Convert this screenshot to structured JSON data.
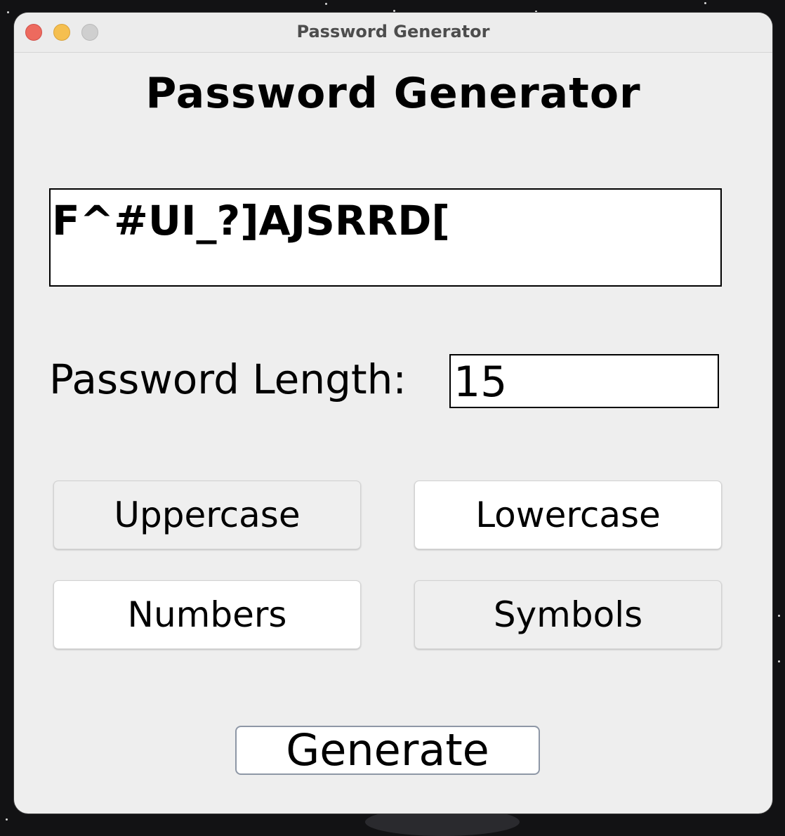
{
  "window": {
    "title": "Password Generator"
  },
  "main": {
    "heading": "Password Generator",
    "password": "F^#UI_?]AJSRRD[",
    "length_label": "Password Length:",
    "length_value": "15"
  },
  "options": {
    "uppercase": "Uppercase",
    "lowercase": "Lowercase",
    "numbers": "Numbers",
    "symbols": "Symbols"
  },
  "actions": {
    "generate": "Generate"
  },
  "colors": {
    "window_bg": "#eeeeee",
    "close": "#ed6a5e",
    "minimize": "#f5bf4f",
    "zoom_disabled": "#cfcfcf",
    "generate_border": "#8e97a6"
  }
}
